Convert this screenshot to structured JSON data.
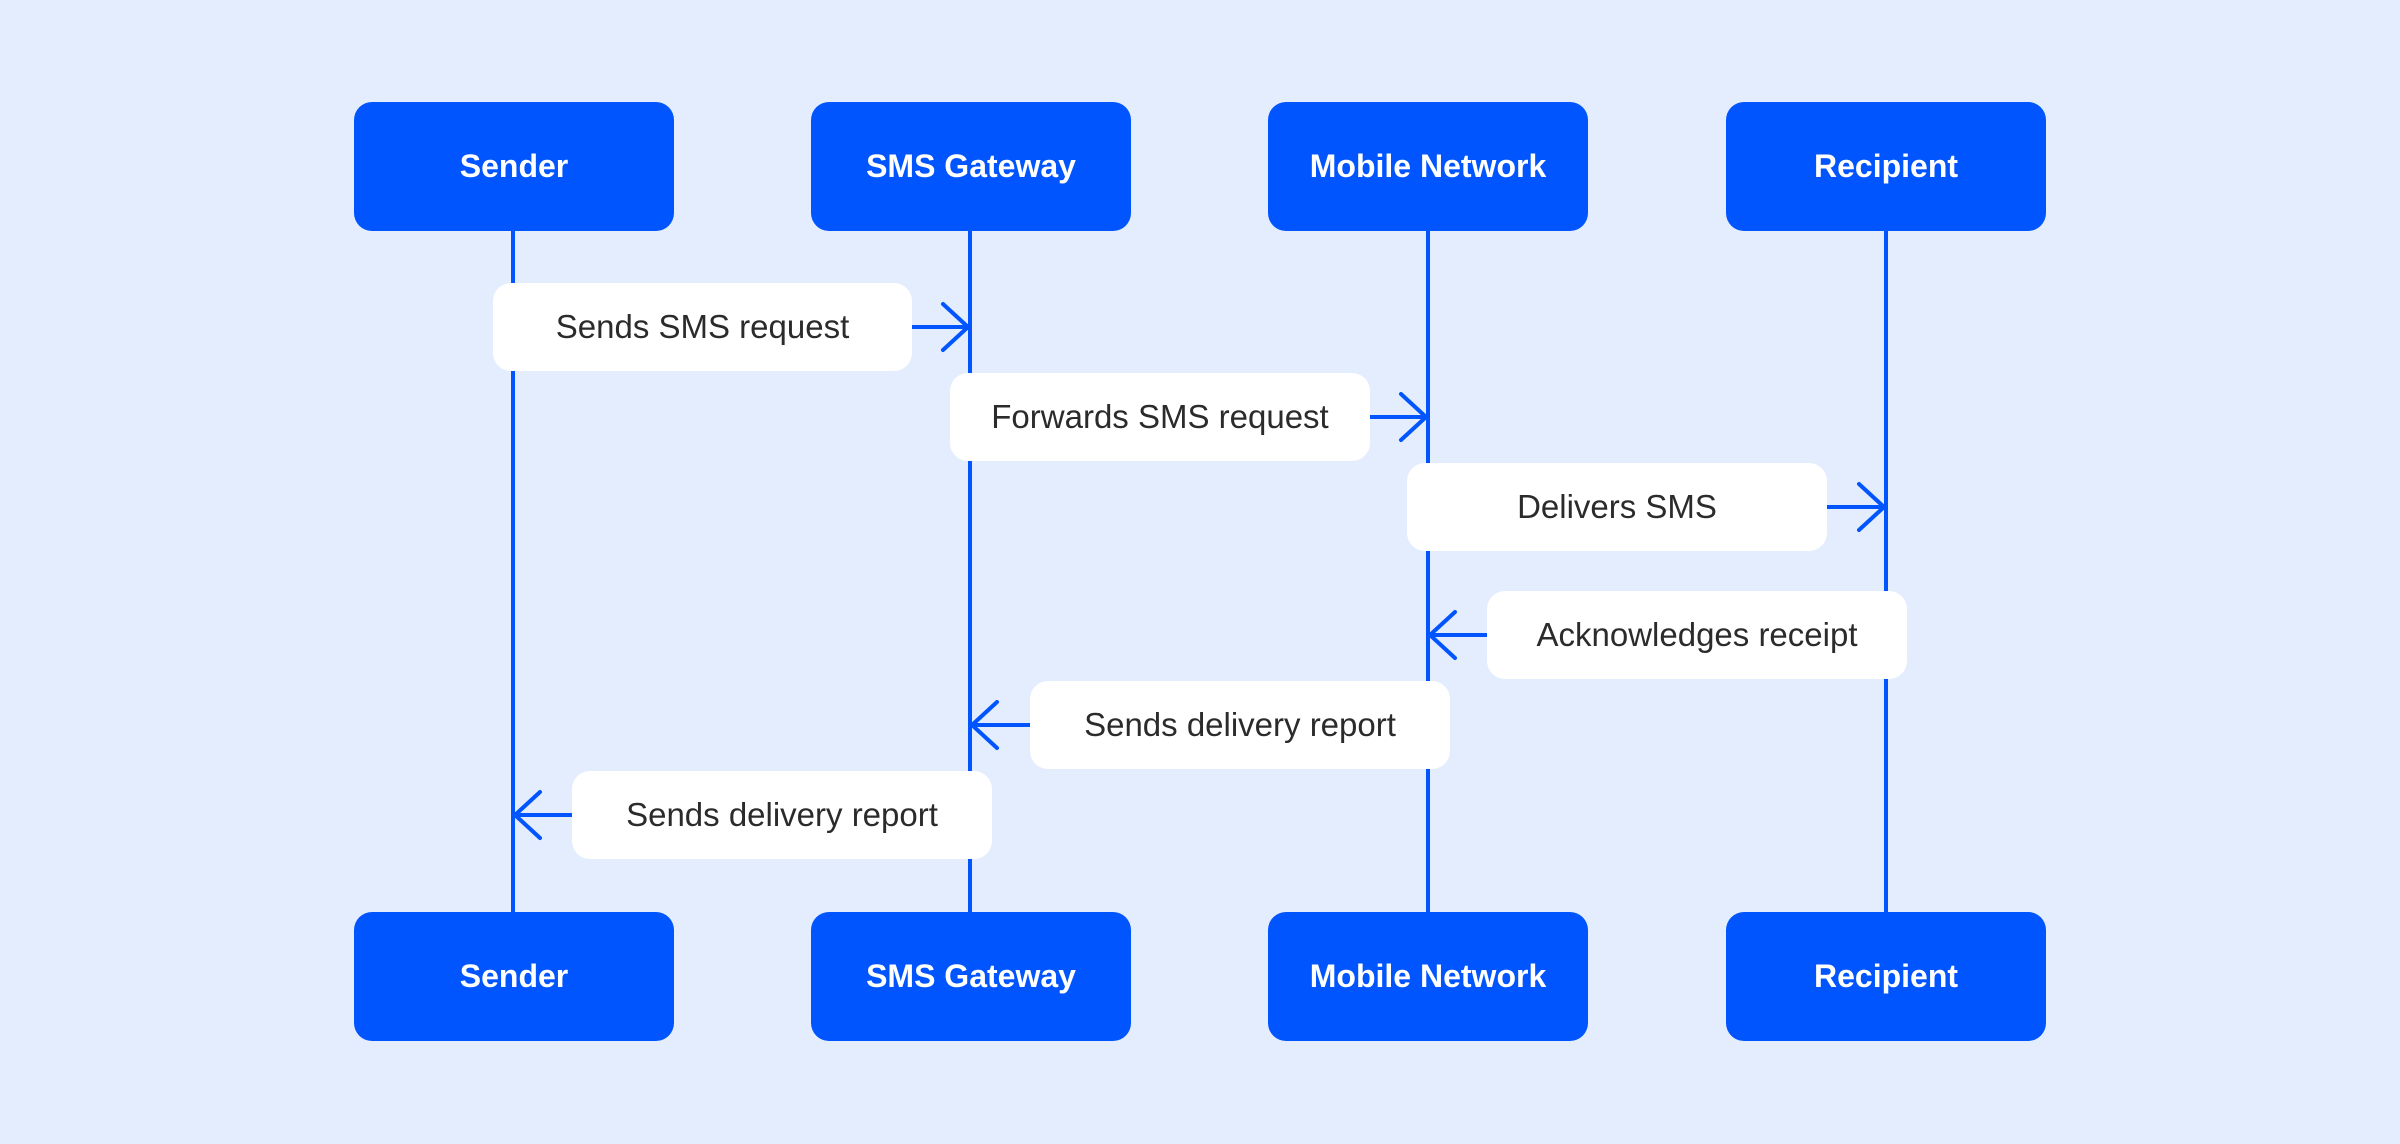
{
  "participants": [
    "Sender",
    "SMS Gateway",
    "Mobile Network",
    "Recipient"
  ],
  "messages": [
    {
      "label": "Sends SMS request",
      "from": 0,
      "to": 1
    },
    {
      "label": "Forwards SMS request",
      "from": 1,
      "to": 2
    },
    {
      "label": "Delivers SMS",
      "from": 2,
      "to": 3
    },
    {
      "label": "Acknowledges receipt",
      "from": 3,
      "to": 2
    },
    {
      "label": "Sends delivery report",
      "from": 2,
      "to": 1
    },
    {
      "label": "Sends delivery report",
      "from": 1,
      "to": 0
    }
  ],
  "colors": {
    "accent": "#0055ff",
    "background": "#e3edfd",
    "label_bg": "#ffffff"
  }
}
